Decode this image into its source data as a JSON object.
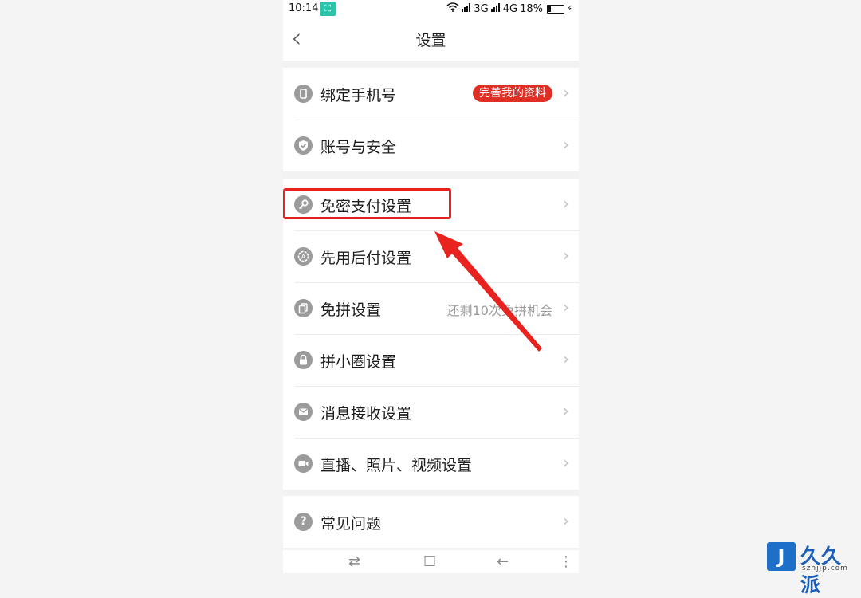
{
  "status_bar": {
    "time": "10:14",
    "app_icon": "scan-icon",
    "net1": "3G",
    "net2": "4G",
    "battery": "18%"
  },
  "header": {
    "title": "设置",
    "back_icon": "chevron-left-icon"
  },
  "groups": [
    {
      "items": [
        {
          "label": "绑定手机号",
          "icon": "phone-icon",
          "badge": "完善我的资料"
        },
        {
          "label": "账号与安全",
          "icon": "shield-check-icon"
        }
      ]
    },
    {
      "items": [
        {
          "label": "免密支付设置",
          "icon": "key-icon"
        },
        {
          "label": "先用后付设置",
          "icon": "badge-a-icon"
        },
        {
          "label": "免拼设置",
          "icon": "cards-icon",
          "hint": "还剩10次免拼机会"
        },
        {
          "label": "拼小圈设置",
          "icon": "lock-icon"
        },
        {
          "label": "消息接收设置",
          "icon": "mail-icon"
        },
        {
          "label": "直播、照片、视频设置",
          "icon": "video-icon"
        }
      ]
    },
    {
      "items": [
        {
          "label": "常见问题",
          "icon": "question-icon"
        }
      ]
    }
  ],
  "annotation": {
    "highlight_color": "#e8231f"
  },
  "colors": {
    "badge_bg": "#e02e24",
    "accent": "#e02e24"
  },
  "watermark": {
    "logo_letter": "J",
    "text": "久久派",
    "domain": "szhjjp.com"
  }
}
